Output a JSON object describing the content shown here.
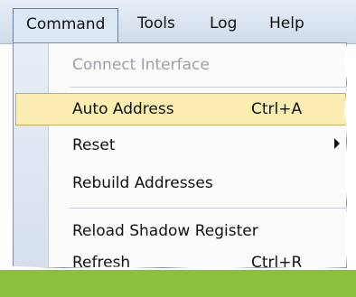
{
  "menubar": {
    "items": [
      {
        "label": "Command"
      },
      {
        "label": "Tools"
      },
      {
        "label": "Log"
      },
      {
        "label": "Help"
      }
    ]
  },
  "dropdown": {
    "items": [
      {
        "label": "Connect Interface",
        "shortcut": "",
        "disabled": true
      },
      {
        "label": "Auto Address",
        "shortcut": "Ctrl+A",
        "highlighted": true
      },
      {
        "label": "Reset",
        "shortcut": "",
        "has_submenu": true
      },
      {
        "label": "Rebuild Addresses",
        "shortcut": ""
      },
      {
        "label": "Reload Shadow Register",
        "shortcut": ""
      },
      {
        "label": "Refresh",
        "shortcut": "Ctrl+R"
      }
    ]
  }
}
